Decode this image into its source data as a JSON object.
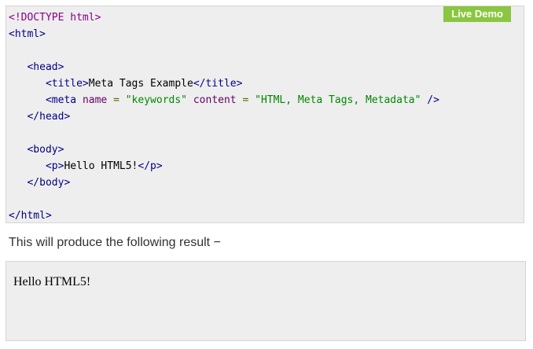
{
  "live_demo_label": "Live Demo",
  "code": {
    "line1": "<!DOCTYPE html>",
    "line2_tag": "<html>",
    "line4_tag": "<head>",
    "line5_open": "<title>",
    "line5_text": "Meta Tags Example",
    "line5_close": "</title>",
    "line6_open": "<meta",
    "line6_attr1": "name",
    "line6_eq1": " = ",
    "line6_val1": "\"keywords\"",
    "line6_attr2": "content",
    "line6_eq2": " = ",
    "line6_val2": "\"HTML, Meta Tags, Metadata\"",
    "line6_close": "/>",
    "line7_tag": "</head>",
    "line9_tag": "<body>",
    "line10_open": "<p>",
    "line10_text": "Hello HTML5!",
    "line10_close": "</p>",
    "line11_tag": "</body>",
    "line13_tag": "</html>"
  },
  "result_label": "This will produce the following result −",
  "result_output": "Hello HTML5!",
  "colors": {
    "live_demo_bg": "#8ac640",
    "code_bg": "#eeeeee",
    "tag": "#000088",
    "attribute": "#660066",
    "string": "#008800"
  }
}
